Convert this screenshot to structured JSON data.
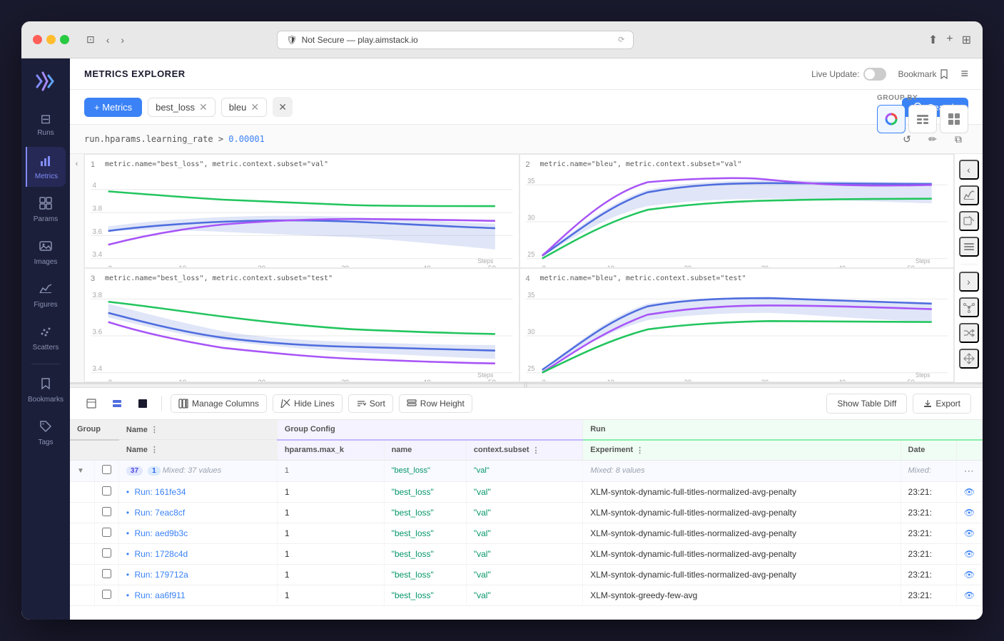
{
  "browser": {
    "url": "Not Secure — play.aimstack.io",
    "shield_icon": "🛡"
  },
  "header": {
    "title": "METRICS EXPLORER",
    "live_update_label": "Live Update:",
    "bookmark_label": "Bookmark",
    "menu_icon": "≡"
  },
  "toolbar": {
    "add_metrics_label": "+ Metrics",
    "metric_tags": [
      "best_loss",
      "bleu"
    ],
    "search_label": "Search",
    "group_by_label": "GROUP BY"
  },
  "filter": {
    "text": "run.hparams.learning_rate > 0.00001"
  },
  "charts": [
    {
      "id": 1,
      "title": "metric.name=\"best_loss\", metric.context.subset=\"val\"",
      "y_values": [
        4,
        3.8,
        3.6,
        3.4
      ],
      "x_label": "Steps"
    },
    {
      "id": 2,
      "title": "metric.name=\"bleu\", metric.context.subset=\"val\"",
      "y_values": [
        25,
        30,
        35
      ],
      "x_label": "Steps"
    },
    {
      "id": 3,
      "title": "metric.name=\"best_loss\", metric.context.subset=\"test\"",
      "y_values": [
        3.8,
        3.6,
        3.4
      ],
      "x_label": "Steps"
    },
    {
      "id": 4,
      "title": "metric.name=\"bleu\", metric.context.subset=\"test\"",
      "y_values": [
        25,
        30,
        35
      ],
      "x_label": "Steps"
    }
  ],
  "table_toolbar": {
    "manage_columns_label": "Manage Columns",
    "hide_lines_label": "Hide Lines",
    "sort_label": "Sort",
    "row_height_label": "Row Height",
    "show_table_diff_label": "Show Table Diff",
    "export_label": "Export"
  },
  "table": {
    "group_header": "Group",
    "run_header": "Run",
    "group_config_header": "Group Config",
    "run_sub_header": "Run",
    "columns": {
      "name": "Name",
      "hparams_max_k": "hparams.max_k",
      "name_col": "name",
      "context_subset": "context.subset",
      "experiment": "Experiment",
      "date": "Date"
    },
    "group_row": {
      "count": "37",
      "badge_one": "1",
      "mixed_values": "Mixed: 37 values",
      "hparams_val": "1",
      "name_val": "\"best_loss\"",
      "context_val": "\"val\"",
      "experiment_mixed": "Mixed: 8 values",
      "date_mixed": "Mixed:"
    },
    "rows": [
      {
        "run_id": "161fe34",
        "hparams": "1",
        "name": "\"best_loss\"",
        "context": "\"val\"",
        "experiment": "XLM-syntok-dynamic-full-titles-normalized-avg-penalty",
        "date": "23:21:"
      },
      {
        "run_id": "7eac8cf",
        "hparams": "1",
        "name": "\"best_loss\"",
        "context": "\"val\"",
        "experiment": "XLM-syntok-dynamic-full-titles-normalized-avg-penalty",
        "date": "23:21:"
      },
      {
        "run_id": "aed9b3c",
        "hparams": "1",
        "name": "\"best_loss\"",
        "context": "\"val\"",
        "experiment": "XLM-syntok-dynamic-full-titles-normalized-avg-penalty",
        "date": "23:21:"
      },
      {
        "run_id": "1728c4d",
        "hparams": "1",
        "name": "\"best_loss\"",
        "context": "\"val\"",
        "experiment": "XLM-syntok-dynamic-full-titles-normalized-avg-penalty",
        "date": "23:21:"
      },
      {
        "run_id": "179712a",
        "hparams": "1",
        "name": "\"best_loss\"",
        "context": "\"val\"",
        "experiment": "XLM-syntok-dynamic-full-titles-normalized-avg-penalty",
        "date": "23:21:"
      },
      {
        "run_id": "aa6f911",
        "hparams": "1",
        "name": "\"best_loss\"",
        "context": "\"val\"",
        "experiment": "XLM-syntok-greedy-few-avg",
        "date": "23:21:"
      }
    ]
  },
  "sidebar": {
    "items": [
      {
        "label": "Runs",
        "icon": "≡"
      },
      {
        "label": "Metrics",
        "icon": "📊"
      },
      {
        "label": "Params",
        "icon": "⊞"
      },
      {
        "label": "Images",
        "icon": "🖼"
      },
      {
        "label": "Figures",
        "icon": "📈"
      },
      {
        "label": "Scatters",
        "icon": "⠿"
      },
      {
        "label": "Bookmarks",
        "icon": "🔖"
      },
      {
        "label": "Tags",
        "icon": "🏷"
      }
    ]
  },
  "right_panel": {
    "icons": [
      "⊕",
      "📊",
      "≡",
      "✦",
      "⟳",
      "✦",
      "↔"
    ]
  }
}
